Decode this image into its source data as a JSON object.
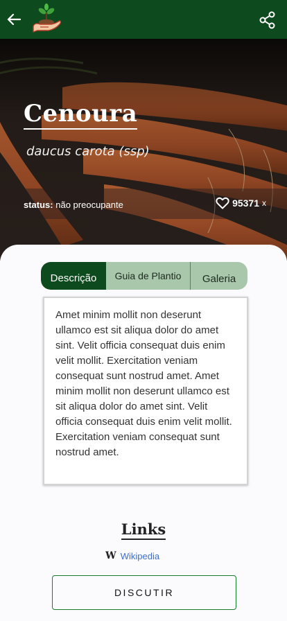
{
  "app": {
    "logo_icon": "hand-with-seedling-icon",
    "back_icon": "arrow-left-icon",
    "share_icon": "share-icon"
  },
  "plant": {
    "name": "Cenoura",
    "scientific_name": "daucus carota (ssp)",
    "status_label": "status:",
    "status_value": "não preocupante",
    "likes": "95371",
    "likes_suffix": "x"
  },
  "tabs": [
    {
      "label": "Descrição",
      "active": true
    },
    {
      "label": "Guia de Plantio",
      "active": false
    },
    {
      "label": "Galeria",
      "active": false
    }
  ],
  "description": "Amet minim mollit non deserunt ullamco est sit aliqua dolor do amet sint. Velit officia consequat duis enim velit mollit. Exercitation veniam consequat sunt nostrud amet. Amet minim mollit non deserunt ullamco est sit aliqua dolor do amet sint. Velit officia consequat duis enim velit mollit. Exercitation veniam consequat sunt nostrud amet.",
  "links": {
    "title": "Links",
    "items": [
      {
        "glyph": "W",
        "label": "Wikipedia"
      }
    ]
  },
  "actions": {
    "discuss": "DISCUTIR"
  },
  "colors": {
    "primary": "#0d4a1d",
    "tab_inactive": "#a9c7ab",
    "link": "#3f6fc9",
    "button_border": "#177a2e"
  }
}
